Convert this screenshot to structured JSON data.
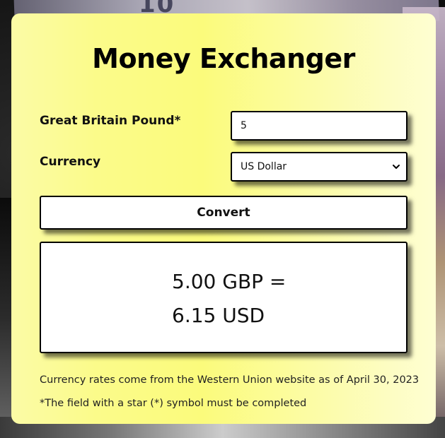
{
  "app": {
    "title": "Money Exchanger"
  },
  "form": {
    "amount_label": "Great Britain Pound*",
    "amount_value": "5",
    "currency_label": "Currency",
    "currency_selected": "US Dollar",
    "convert_label": "Convert"
  },
  "result": {
    "line1": "5.00 GBP =",
    "line2": "6.15 USD"
  },
  "notes": {
    "rates_source": "Currency rates come from the Western Union website as of April 30, 2023",
    "required_hint": "*The field with a star (*) symbol must be completed"
  },
  "background": {
    "digits": "10"
  },
  "icons": {
    "select_arrow": "chevron-down-icon"
  },
  "colors": {
    "card_gradient_start": "#fbfba6",
    "card_gradient_end": "#fefed2",
    "border": "#000000"
  }
}
